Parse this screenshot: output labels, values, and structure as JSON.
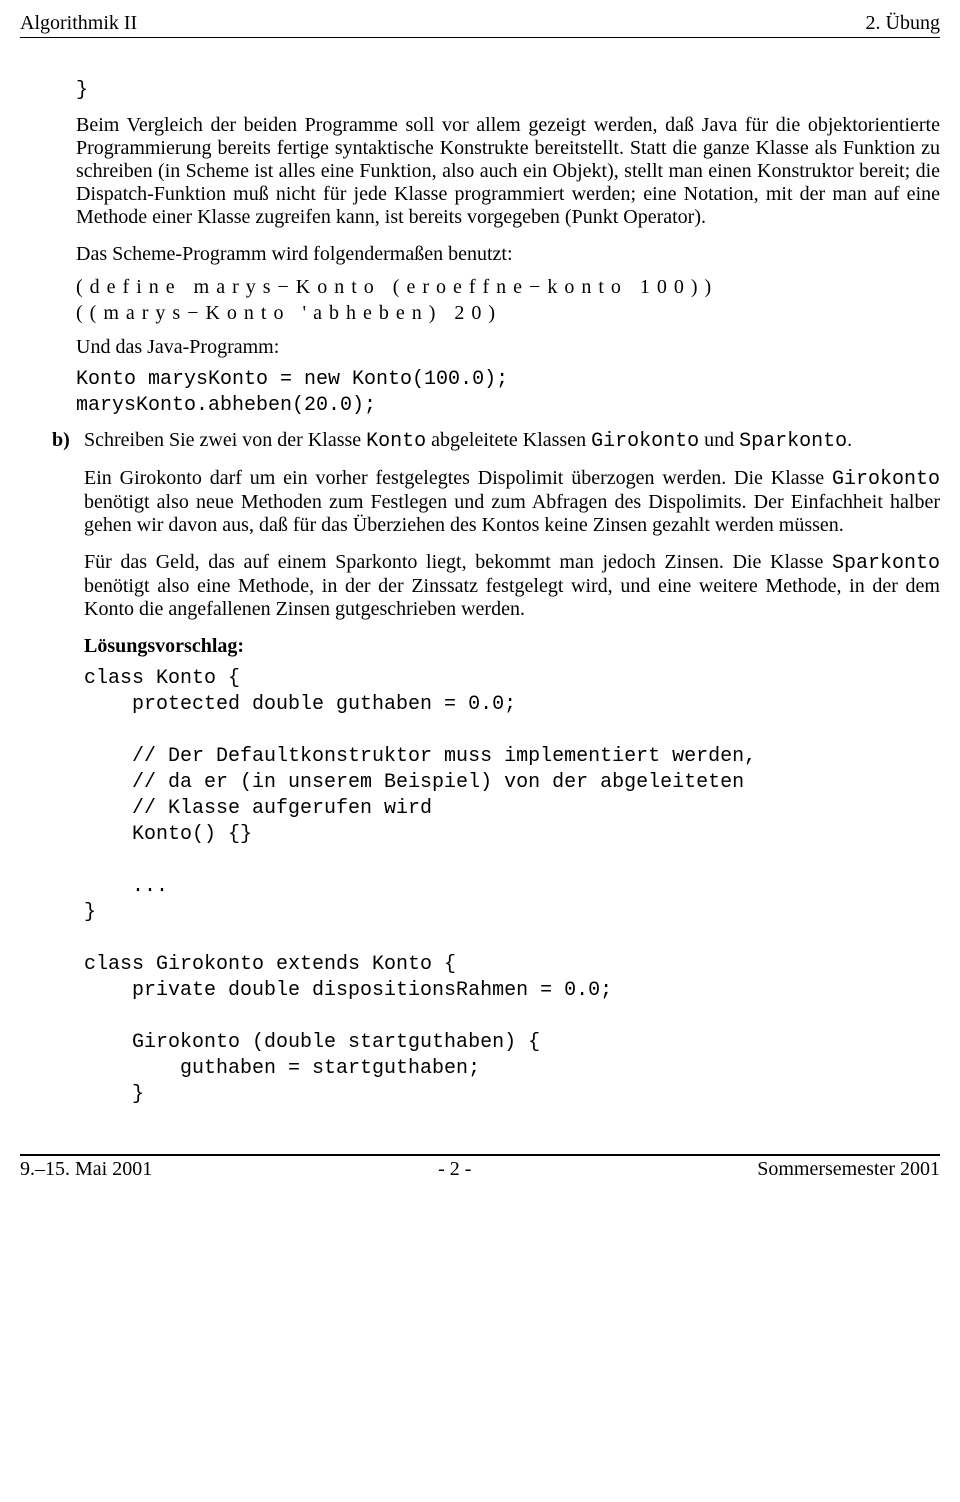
{
  "header": {
    "left": "Algorithmik II",
    "right": "2. Übung"
  },
  "footer": {
    "left": "9.–15. Mai 2001",
    "center": "- 2 -",
    "right": "Sommersemester 2001"
  },
  "body": {
    "closebrace": "}",
    "para1": "Beim Vergleich der beiden Programme soll vor allem gezeigt werden, daß Java für die objektorientierte Programmierung bereits fertige syntaktische Konstrukte bereitstellt. Statt die ganze Klasse als Funktion zu schreiben (in Scheme ist alles eine Funktion, also auch ein Objekt), stellt man einen Konstruktor bereit; die Dispatch-Funktion muß nicht für jede Klasse programmiert werden; eine Notation, mit der man auf eine Methode einer Klasse zugreifen kann, ist bereits vorgegeben (Punkt Operator).",
    "para2": "Das Scheme-Programm wird folgendermaßen benutzt:",
    "scheme_code": "( d e f i n e   m a r y s − K o n t o   ( e r o e f f n e − k o n t o   1 0 0 ) )\n( ( m a r y s − K o n t o   ' a b h e b e n )   2 0 )",
    "para3": "Und das Java-Programm:",
    "java_code1": "Konto marysKonto = new Konto(100.0);\nmarysKonto.abheben(20.0);",
    "itemB": {
      "marker": "b)",
      "line1_pre": "Schreiben Sie zwei von der Klasse ",
      "line1_code1": "Konto",
      "line1_mid": " abgeleitete Klassen ",
      "line1_code2": "Girokonto",
      "line1_mid2": " und ",
      "line1_code3": "Sparkonto",
      "line1_post": ".",
      "line2_pre": "Ein Girokonto darf um ein vorher festgelegtes Dispolimit überzogen werden. Die Klasse ",
      "line2_code1": "Girokonto",
      "line2_post": " benötigt also neue Methoden zum Festlegen und zum Abfragen des Dispolimits. Der Einfachheit halber gehen wir davon aus, daß für das Überziehen des Kontos keine Zinsen gezahlt werden müssen.",
      "line3_pre": "Für das Geld, das auf einem Sparkonto liegt, bekommt man jedoch Zinsen. Die Klasse ",
      "line3_code1": "Sparkonto",
      "line3_post": " benötigt also eine Methode, in der der Zinssatz festgelegt wird, und eine weitere Methode, in der dem Konto die angefallenen Zinsen gutgeschrieben werden.",
      "solution_label": "Lösungsvorschlag:",
      "code2": "class Konto {\n    protected double guthaben = 0.0;\n\n    // Der Defaultkonstruktor muss implementiert werden,\n    // da er (in unserem Beispiel) von der abgeleiteten\n    // Klasse aufgerufen wird\n    Konto() {}\n\n    ...\n}\n\nclass Girokonto extends Konto {\n    private double dispositionsRahmen = 0.0;\n\n    Girokonto (double startguthaben) {\n        guthaben = startguthaben;\n    }"
    }
  }
}
